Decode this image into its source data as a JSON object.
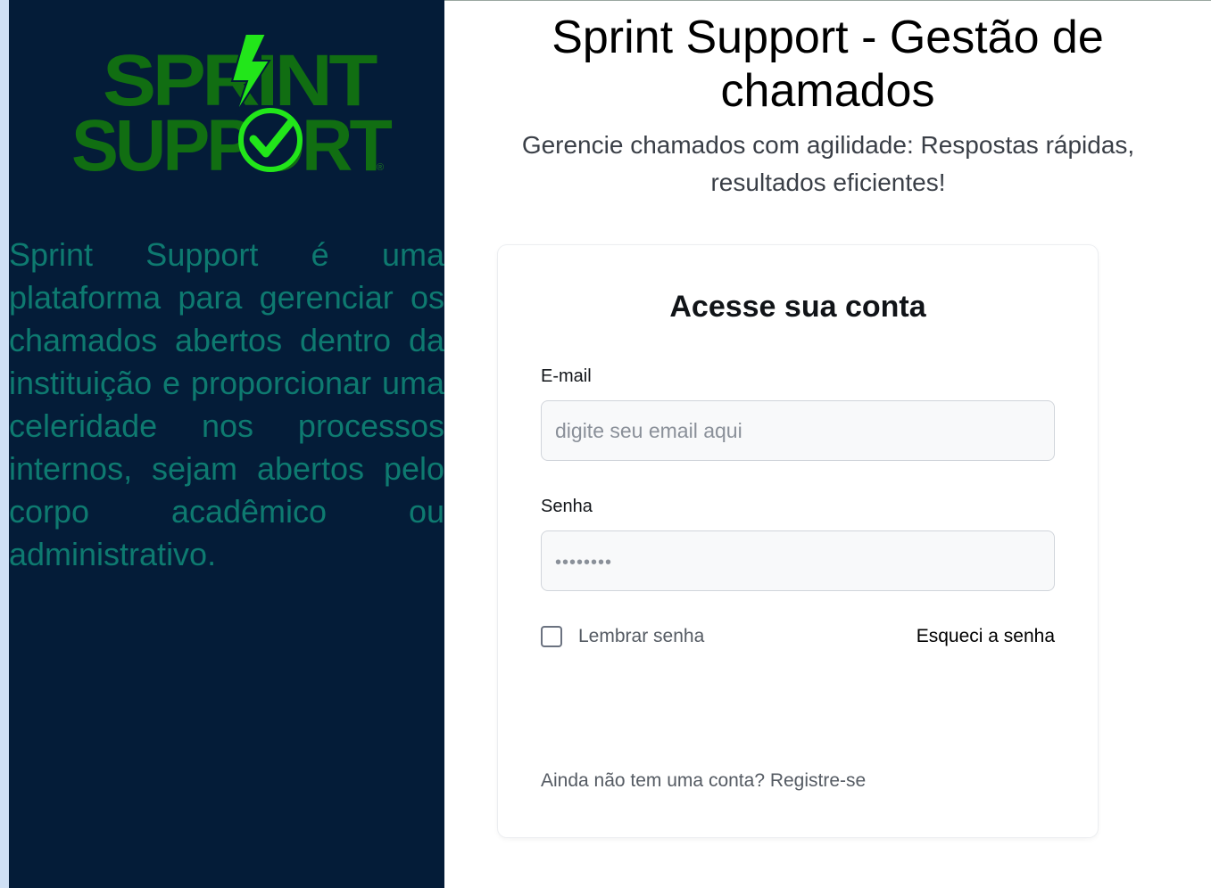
{
  "sidebar": {
    "logo": {
      "line1": "SPRINT",
      "line2": "SUPPORT",
      "registered": "®",
      "word_color": "#116e12",
      "accent_color": "#22e61a"
    },
    "description": "Sprint Support é uma plataforma para gerenciar os chamados abertos dentro da instituição e proporcionar uma celeridade nos processos internos, sejam abertos pelo corpo acadêmico ou administrativo."
  },
  "header": {
    "title": "Sprint Support - Gestão de chamados",
    "subtitle": "Gerencie chamados com agilidade: Respostas rápidas, resultados eficientes!"
  },
  "login": {
    "title": "Acesse sua conta",
    "email_label": "E-mail",
    "email_placeholder": "digite seu email aqui",
    "email_value": "",
    "password_label": "Senha",
    "password_placeholder": "••••••••",
    "password_value": "",
    "remember_label": "Lembrar senha",
    "remember_checked": false,
    "forgot_link": "Esqueci a senha",
    "register_text": "Ainda não tem uma conta? Registre-se"
  },
  "colors": {
    "sidebar_bg": "#041c38",
    "sidebar_text": "#0e7a70",
    "logo_green": "#116e12",
    "bolt_green": "#22e61a"
  }
}
